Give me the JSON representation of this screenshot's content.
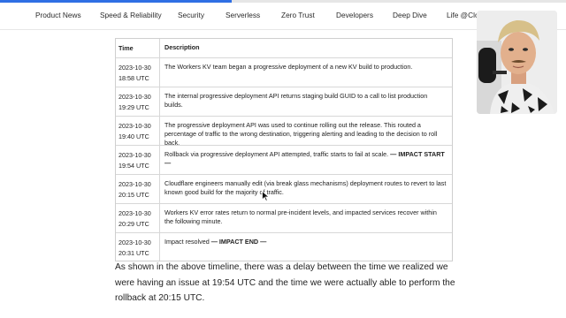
{
  "nav": {
    "items": [
      {
        "label": "Product News"
      },
      {
        "label": "Speed & Reliability"
      },
      {
        "label": "Security"
      },
      {
        "label": "Serverless"
      },
      {
        "label": "Zero Trust"
      },
      {
        "label": "Developers"
      },
      {
        "label": "Deep Dive"
      },
      {
        "label": "Life @Clou"
      }
    ]
  },
  "table": {
    "headers": {
      "time": "Time",
      "description": "Description"
    },
    "rows": [
      {
        "date": "2023-10-30",
        "time": "18:58 UTC",
        "text": "The Workers KV team began a progressive deployment of a new KV build to production.",
        "emph": ""
      },
      {
        "date": "2023-10-30",
        "time": "19:29 UTC",
        "text": "The internal progressive deployment API returns staging build GUID to a call to list production builds.",
        "emph": ""
      },
      {
        "date": "2023-10-30",
        "time": "19:40 UTC",
        "text": "The progressive deployment API was used to continue rolling out the release. This routed a percentage of traffic to the wrong destination, triggering alerting and leading to the decision to roll back.",
        "emph": ""
      },
      {
        "date": "2023-10-30",
        "time": "19:54 UTC",
        "text": "Rollback via progressive deployment API attempted, traffic starts to fail at scale.",
        "emph": "— IMPACT START —"
      },
      {
        "date": "2023-10-30",
        "time": "20:15 UTC",
        "text": "Cloudflare engineers manually edit (via break glass mechanisms) deployment routes to revert to last known good build for the majority of traffic.",
        "emph": ""
      },
      {
        "date": "2023-10-30",
        "time": "20:29 UTC",
        "text": "Workers KV error rates return to normal pre-incident levels, and impacted services recover within the following minute.",
        "emph": ""
      },
      {
        "date": "2023-10-30",
        "time": "20:31 UTC",
        "text": "Impact resolved",
        "emph": "— IMPACT END —"
      }
    ]
  },
  "paragraph": "As shown in the above timeline, there was a delay between the time we realized we were having an issue at 19:54 UTC and the time we were actually able to perform the rollback at 20:15 UTC.",
  "colors": {
    "progress": "#2f6fe4",
    "border": "#cfcfcf",
    "text": "#222222"
  }
}
